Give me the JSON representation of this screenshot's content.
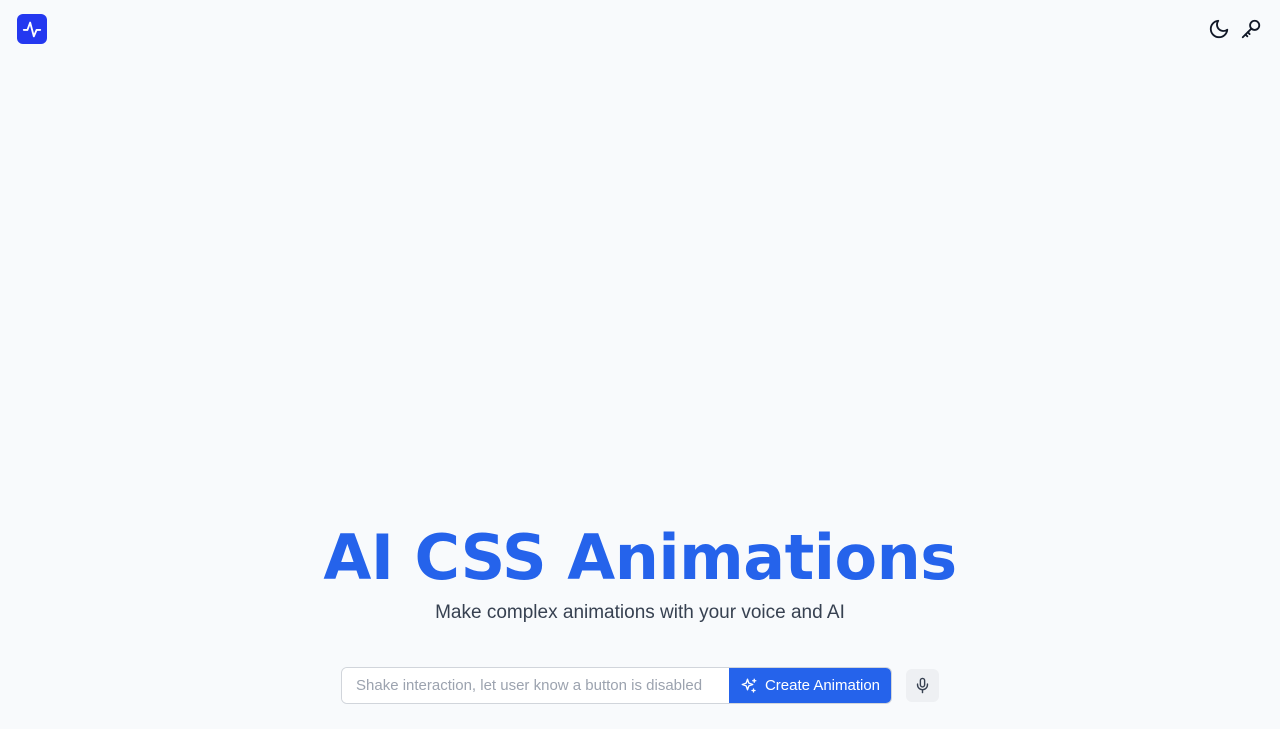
{
  "header": {
    "logo_icon": "activity-pulse-icon",
    "logo_color": "#2438f0",
    "actions": [
      {
        "name": "theme-toggle",
        "icon": "moon-icon"
      },
      {
        "name": "api-key",
        "icon": "key-icon"
      }
    ]
  },
  "hero": {
    "title": "AI CSS Animations",
    "subtitle": "Make complex animations with your voice and AI",
    "accent_color": "#2563eb"
  },
  "form": {
    "placeholder": "Shake interaction, let user know a button is disabled",
    "value": "",
    "submit_label": "Create Animation",
    "submit_icon": "sparkles-icon",
    "mic_icon": "microphone-icon"
  }
}
